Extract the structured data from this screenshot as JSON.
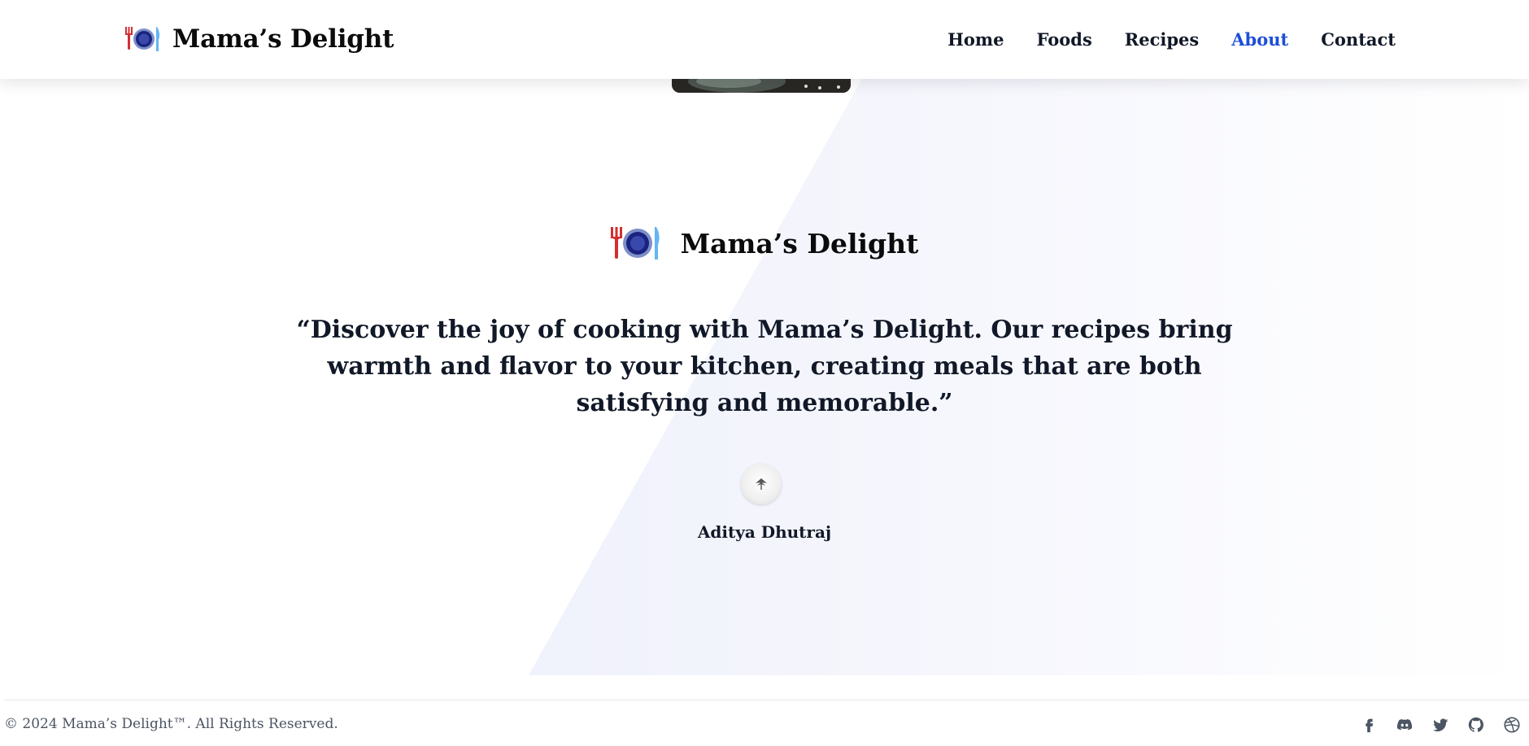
{
  "brand": {
    "name": "Mama’s Delight",
    "icon": "plate-fork-knife-icon"
  },
  "nav": {
    "items": [
      {
        "label": "Home"
      },
      {
        "label": "Foods"
      },
      {
        "label": "Recipes"
      },
      {
        "label": "About",
        "active": true
      },
      {
        "label": "Contact"
      }
    ]
  },
  "hero": {
    "brand_name": "Mama’s Delight",
    "quote_lines": [
      "“Discover the joy of cooking with Mama’s Delight. Our recipes bring",
      "warmth and flavor to your kitchen, creating meals that are both",
      "satisfying and memorable.”"
    ],
    "author": "Aditya Dhutraj"
  },
  "footer": {
    "copyright": "© 2024 Mama’s Delight™. All Rights Reserved.",
    "socials": [
      "facebook-icon",
      "discord-icon",
      "twitter-icon",
      "github-icon",
      "dribbble-icon"
    ]
  },
  "colors": {
    "accent": "#1d4ed8",
    "text": "#111827",
    "muted": "#4b5563"
  }
}
